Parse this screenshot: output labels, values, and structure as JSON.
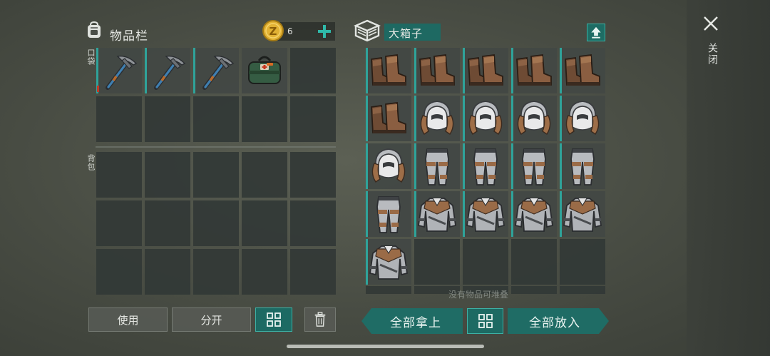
{
  "inventory": {
    "title": "物品栏",
    "backpack_icon": "backpack-icon",
    "coins": "6",
    "coin_icon": "z-coin-icon",
    "pocket_label": "口袋",
    "bag_label": "背包",
    "pocket_items": [
      {
        "name": "pickaxe",
        "icon": "pickaxe-icon"
      },
      {
        "name": "pickaxe",
        "icon": "pickaxe-icon"
      },
      {
        "name": "pickaxe",
        "icon": "pickaxe-icon"
      },
      {
        "name": "medkit bag",
        "icon": "medkit-bag-icon"
      }
    ]
  },
  "container": {
    "title": "大箱子",
    "box_icon": "crate-icon",
    "items": [
      "boots-icon",
      "boots-icon",
      "boots-icon",
      "boots-icon",
      "boots-icon",
      "boots-icon",
      "fur-hat-icon",
      "fur-hat-icon",
      "fur-hat-icon",
      "fur-hat-icon",
      "fur-hat-icon",
      "pants-icon",
      "pants-icon",
      "pants-icon",
      "pants-icon",
      "pants-icon",
      "jacket-icon",
      "jacket-icon",
      "jacket-icon",
      "jacket-icon",
      "jacket-icon"
    ],
    "empty_note": "没有物品可堆叠"
  },
  "buttons": {
    "use": "使用",
    "split": "分开",
    "take_all": "全部拿上",
    "put_all": "全部放入"
  },
  "close": {
    "label": "关闭"
  },
  "colors": {
    "accent_teal": "#2fa39a",
    "button_teal": "#1d6a63",
    "coin_gold": "#e2b234"
  }
}
